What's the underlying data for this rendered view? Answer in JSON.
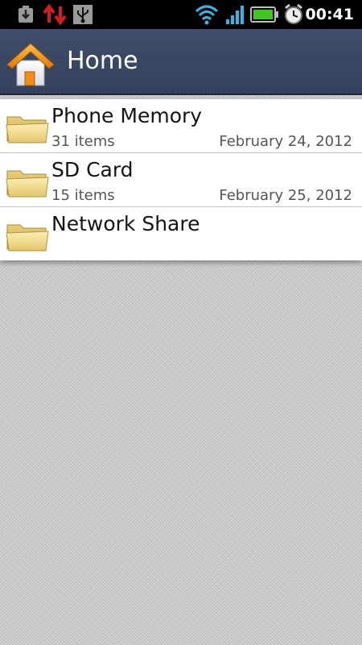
{
  "status_bar": {
    "time": "00:41",
    "icons": [
      "download-notification-icon",
      "data-transfer-icon",
      "usb-icon",
      "wifi-icon",
      "signal-icon",
      "battery-icon",
      "alarm-icon"
    ],
    "colors": {
      "transfer_arrows": "#d21e1e",
      "battery": "#3ec81e",
      "wifi": "#33b5e5"
    }
  },
  "title_bar": {
    "title": "Home",
    "icon": "home-icon",
    "background": "#3a4864"
  },
  "list": {
    "items": [
      {
        "name": "Phone Memory",
        "count": "31 items",
        "date": "February 24, 2012",
        "icon": "folder-icon"
      },
      {
        "name": "SD Card",
        "count": "15 items",
        "date": "February 25, 2012",
        "icon": "folder-icon"
      },
      {
        "name": "Network Share",
        "count": "",
        "date": "",
        "icon": "folder-icon"
      }
    ]
  }
}
